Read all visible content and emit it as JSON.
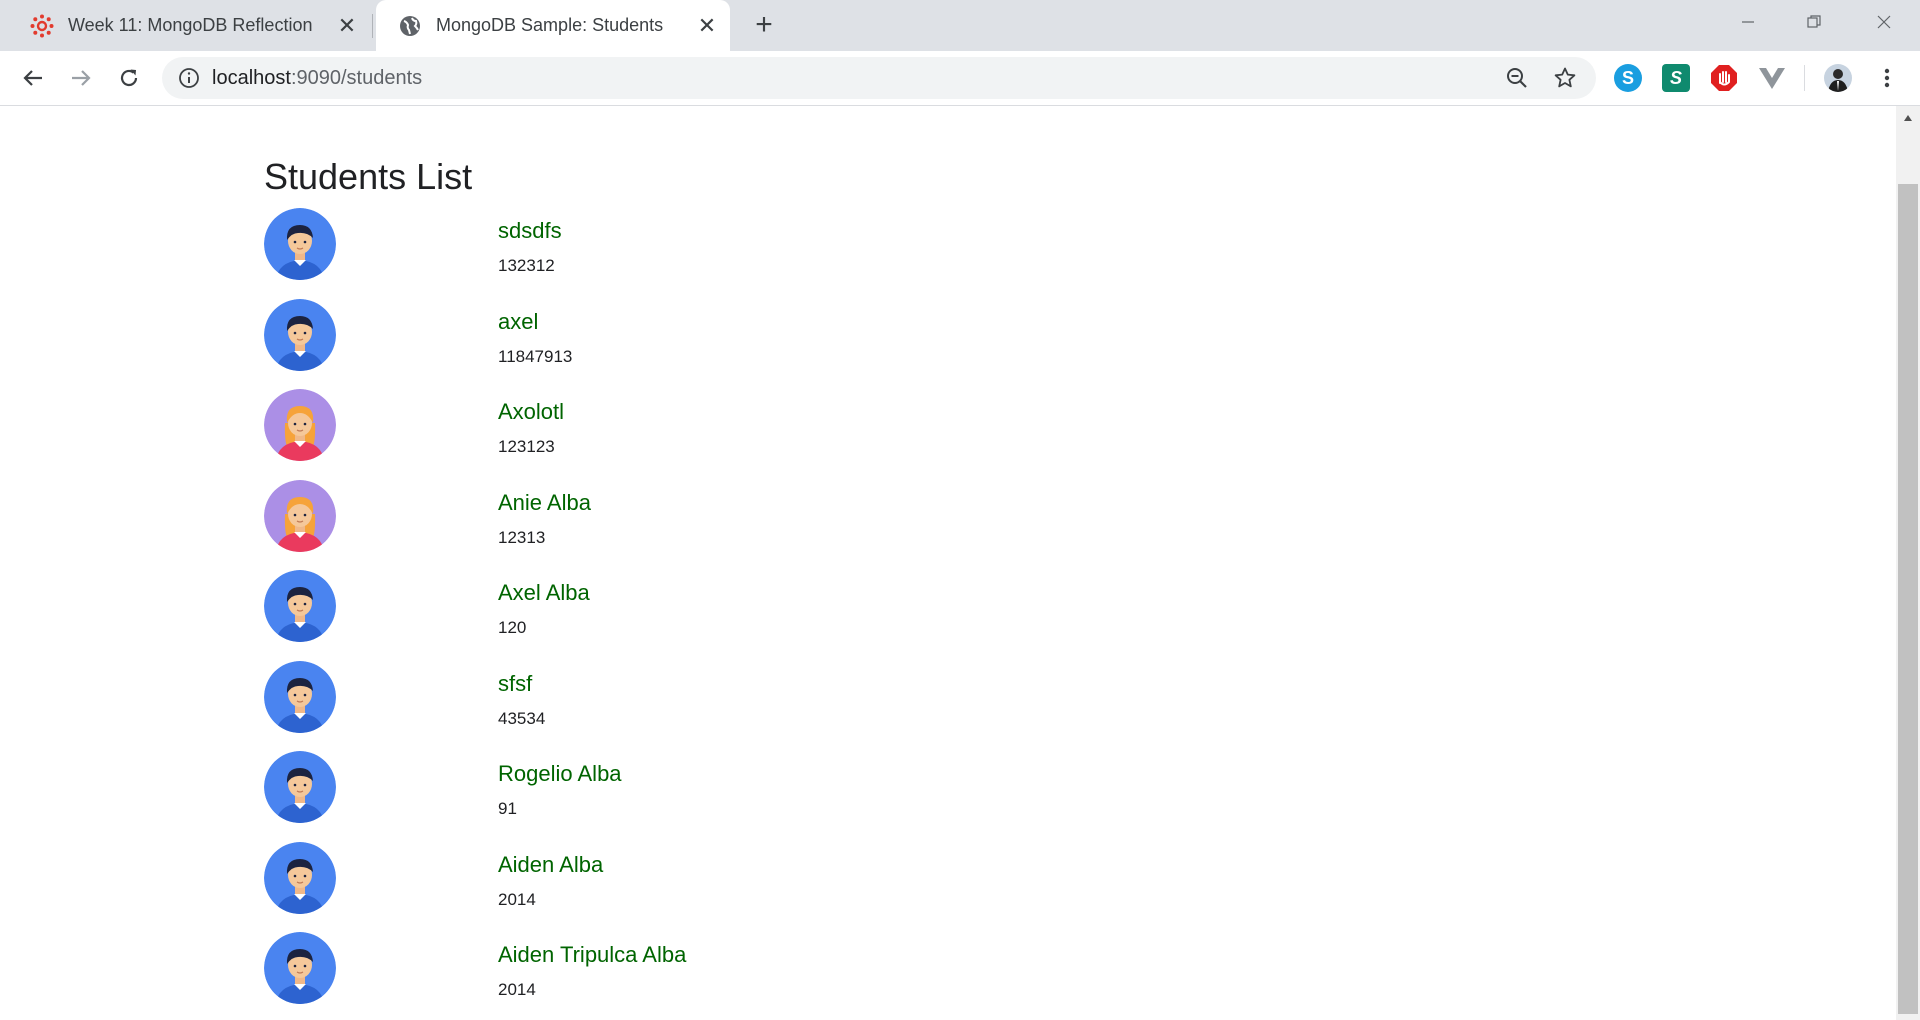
{
  "tabs": [
    {
      "title": "Week 11: MongoDB Reflection",
      "active": false
    },
    {
      "title": "MongoDB Sample: Students",
      "active": true
    }
  ],
  "address_bar": {
    "host": "localhost",
    "path": ":9090/students"
  },
  "page": {
    "title": "Students List",
    "students": [
      {
        "name": "sdsdfs",
        "id": "132312",
        "avatar": "male-avatar"
      },
      {
        "name": "axel",
        "id": "11847913",
        "avatar": "male-avatar"
      },
      {
        "name": "Axolotl",
        "id": "123123",
        "avatar": "female-avatar"
      },
      {
        "name": "Anie Alba",
        "id": "12313",
        "avatar": "female-avatar"
      },
      {
        "name": "Axel Alba",
        "id": "120",
        "avatar": "male-avatar"
      },
      {
        "name": "sfsf",
        "id": "43534",
        "avatar": "male-avatar"
      },
      {
        "name": "Rogelio Alba",
        "id": "91",
        "avatar": "male-avatar"
      },
      {
        "name": "Aiden Alba",
        "id": "2014",
        "avatar": "male-avatar"
      },
      {
        "name": "Aiden Tripulca Alba",
        "id": "2014",
        "avatar": "male-avatar"
      }
    ]
  },
  "colors": {
    "link": "#006400",
    "male_avatar_bg": "#4a84f0",
    "female_avatar_bg": "#ab8fe6"
  }
}
